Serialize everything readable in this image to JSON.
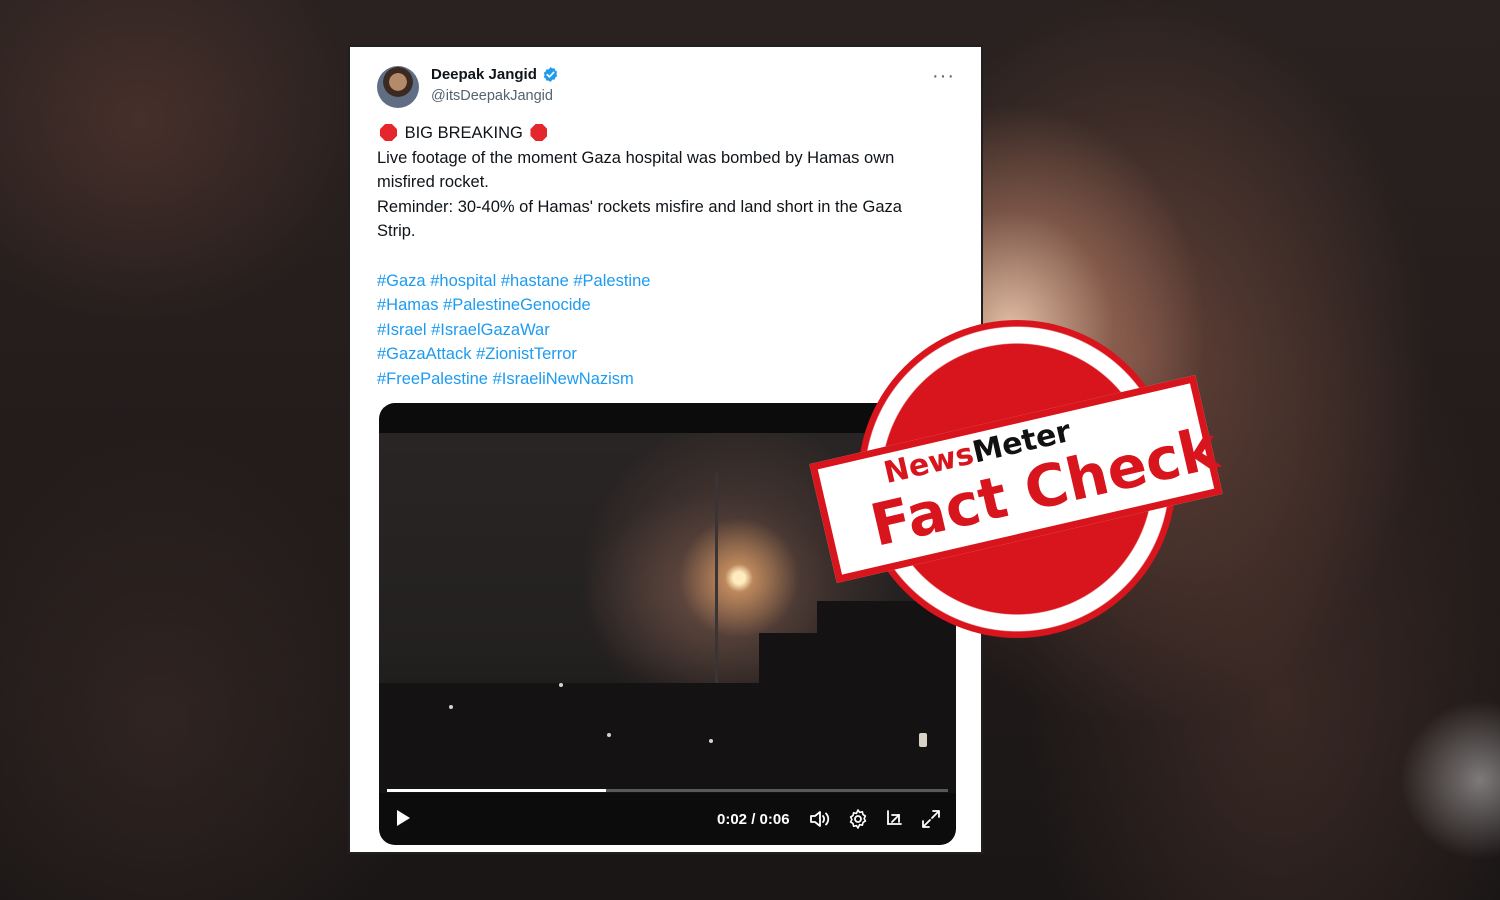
{
  "tweet": {
    "author_name": "Deepak Jangid",
    "handle": "@itsDeepakJangid",
    "more_label": "···",
    "headline": "BIG BREAKING",
    "text_line_1": "Live footage of the moment Gaza hospital was bombed by Hamas own",
    "text_line_2": "misfired rocket.",
    "text_line_3": "Reminder: 30-40% of Hamas' rockets misfire and land short in the Gaza",
    "text_line_4": "Strip.",
    "hashtag_lines": [
      [
        "#Gaza",
        "#hospital",
        "#hastane",
        "#Palestine"
      ],
      [
        "#Hamas",
        "#PalestineGenocide"
      ],
      [
        "#Israel",
        "#IsraelGazaWar"
      ],
      [
        "#GazaAttack",
        "#ZionistTerror"
      ],
      [
        "#FreePalestine",
        "#IsraeliNewNazism"
      ]
    ],
    "verified_color": "#1d9bf0",
    "hashtag_color": "#1d9bf0"
  },
  "video": {
    "time": "0:02 / 0:06",
    "progress": 0.39,
    "play_icon": "play-icon",
    "volume_icon": "volume-icon",
    "settings_icon": "settings-gear-icon",
    "popout_icon": "picture-in-picture-icon",
    "fullscreen_icon": "fullscreen-icon"
  },
  "stamp": {
    "brand_news": "News",
    "brand_meter": "Meter",
    "title": "Fact Check",
    "color": "#d8141d"
  }
}
